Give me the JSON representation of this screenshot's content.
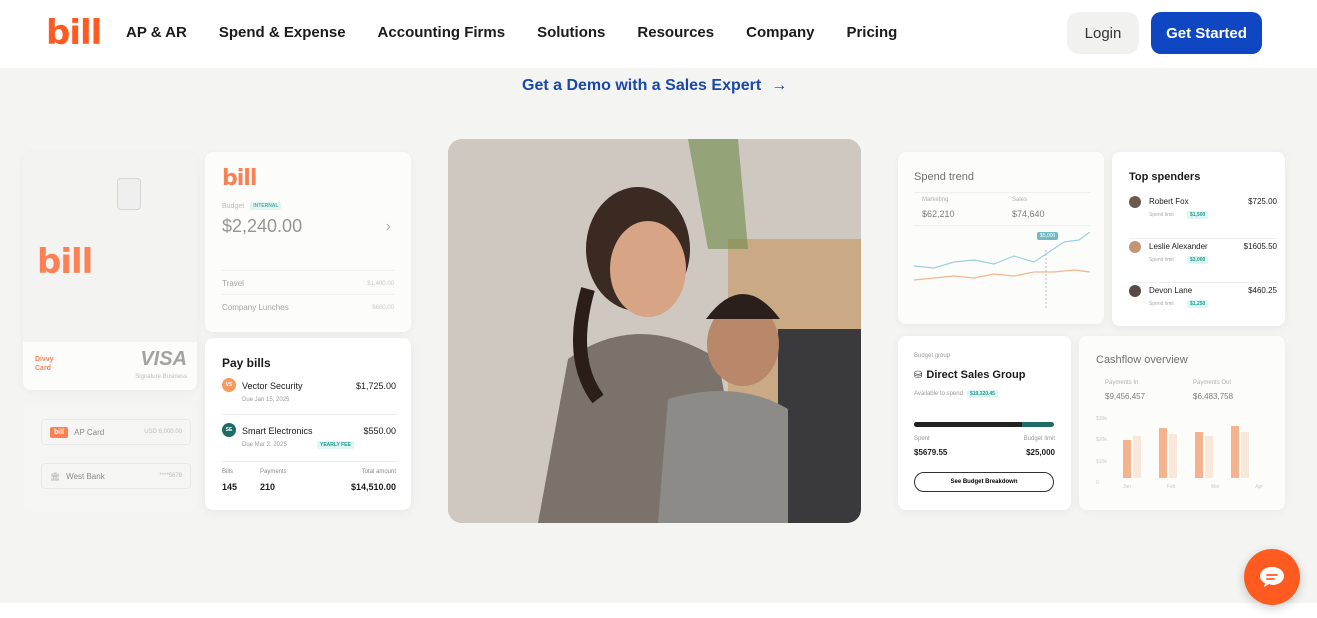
{
  "nav": {
    "logo": "bill",
    "items": [
      "AP & AR",
      "Spend & Expense",
      "Accounting Firms",
      "Solutions",
      "Resources",
      "Company",
      "Pricing"
    ],
    "login": "Login",
    "get_started": "Get Started"
  },
  "demo_link": "Get a Demo with a Sales Expert",
  "divvy_card": {
    "logo": "bill",
    "brand": "Divvy Card",
    "network": "VISA",
    "tier": "Signature Business"
  },
  "budget_card": {
    "logo": "bill",
    "label": "Budget",
    "tag": "INTERNAL",
    "amount": "$2,240.00",
    "rows": [
      {
        "name": "Travel",
        "value": "$1,400.00"
      },
      {
        "name": "Company Lunches",
        "value": "$600.00"
      }
    ]
  },
  "accounts": [
    {
      "badge": "bill",
      "name": "AP Card",
      "value": "USD 6,000.00"
    },
    {
      "badge": "🏛",
      "name": "West Bank",
      "value": "****5678"
    }
  ],
  "pay_bills": {
    "title": "Pay bills",
    "items": [
      {
        "initials": "VS",
        "name": "Vector Security",
        "due": "Due Jan 15, 2025",
        "amount": "$1,725.00",
        "tag": ""
      },
      {
        "initials": "SE",
        "name": "Smart Electronics",
        "due": "Due Mar 2, 2025",
        "amount": "$550.00",
        "tag": "YEARLY FEE"
      }
    ],
    "footer": [
      {
        "label": "Bills",
        "value": "145"
      },
      {
        "label": "Payments",
        "value": "210"
      },
      {
        "label": "Total amount",
        "value": "$14,510.00"
      }
    ]
  },
  "spend_trend": {
    "title": "Spend trend",
    "stats": [
      {
        "label": "Marketing",
        "value": "$62,210"
      },
      {
        "label": "Sales",
        "value": "$74,640"
      }
    ],
    "callout": "$5,000"
  },
  "top_spenders": {
    "title": "Top spenders",
    "people": [
      {
        "name": "Robert Fox",
        "amount": "$725.00",
        "limit": "Spend limit",
        "limit_value": "$1,500"
      },
      {
        "name": "Leslie Alexander",
        "amount": "$1605.50",
        "limit": "Spend limit",
        "limit_value": "$3,000"
      },
      {
        "name": "Devon Lane",
        "amount": "$460.25",
        "limit": "Spend limit",
        "limit_value": "$1,250"
      }
    ]
  },
  "budget_group": {
    "label": "Budget group",
    "name": "Direct Sales Group",
    "available": "Available to spend",
    "available_value": "$19,320.45",
    "spent_label": "Spent",
    "spent": "$5679.55",
    "limit_label": "Budget limit",
    "limit": "$25,000",
    "button": "See Budget Breakdown",
    "progress": 0.23
  },
  "cashflow": {
    "title": "Cashflow overview",
    "stats": [
      {
        "label": "Payments In",
        "value": "$9,456,457"
      },
      {
        "label": "Payments Out",
        "value": "$6,483,758"
      }
    ],
    "yticks": [
      "$30k",
      "$20k",
      "$10k",
      "0"
    ],
    "months": [
      "Jan",
      "Feb",
      "Mar",
      "Apr"
    ]
  },
  "colors": {
    "accent": "#ff5a1f",
    "primary": "#0f47c2",
    "teal": "#1a9e8e"
  }
}
